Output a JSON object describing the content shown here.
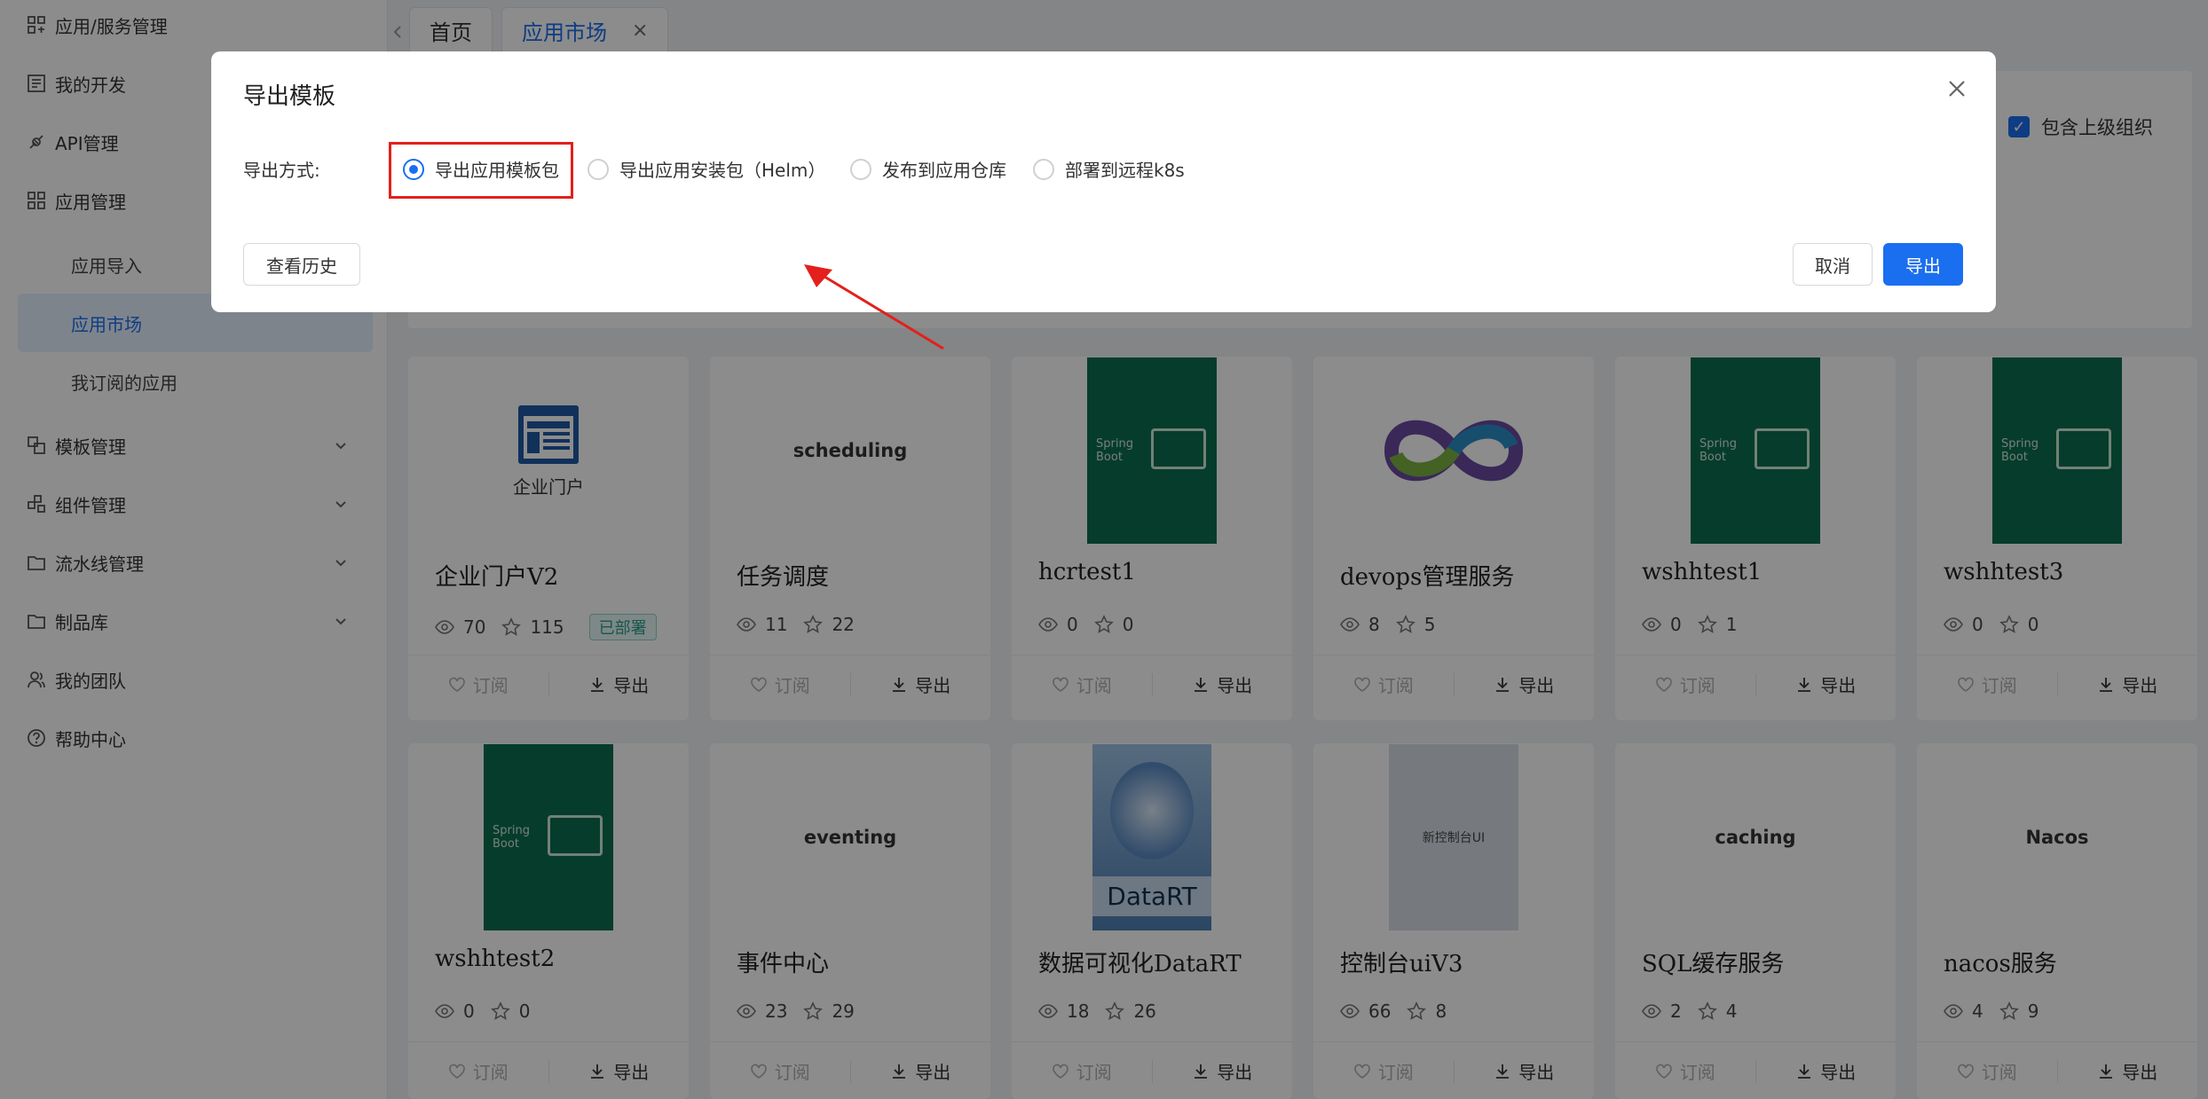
{
  "sidebar": {
    "items": [
      {
        "label": "应用/服务管理",
        "icon": "app-service-icon"
      },
      {
        "label": "我的开发",
        "icon": "dev-icon"
      },
      {
        "label": "API管理",
        "icon": "api-icon"
      },
      {
        "label": "应用管理",
        "icon": "grid-icon"
      },
      {
        "label": "模板管理",
        "icon": "template-icon"
      },
      {
        "label": "组件管理",
        "icon": "component-icon"
      },
      {
        "label": "流水线管理",
        "icon": "folder-icon"
      },
      {
        "label": "制品库",
        "icon": "folder-icon"
      },
      {
        "label": "我的团队",
        "icon": "team-icon"
      },
      {
        "label": "帮助中心",
        "icon": "help-icon"
      }
    ],
    "sub_items": [
      "应用导入",
      "应用市场",
      "我订阅的应用"
    ]
  },
  "tabs": [
    {
      "label": "首页"
    },
    {
      "label": "应用市场",
      "close": "×"
    }
  ],
  "toolbar": {
    "include_parent_label": "包含上级组织"
  },
  "cards": [
    {
      "title": "企业门户V2",
      "views": "70",
      "stars": "115",
      "badge": "已部署",
      "thumb_text": "企业门户",
      "thumb": "portal"
    },
    {
      "title": "任务调度",
      "views": "11",
      "stars": "22",
      "thumb_text": "scheduling",
      "thumb": "word"
    },
    {
      "title": "hcrtest1",
      "views": "0",
      "stars": "0",
      "thumb": "spring"
    },
    {
      "title": "devops管理服务",
      "views": "8",
      "stars": "5",
      "thumb": "devops"
    },
    {
      "title": "wshhtest1",
      "views": "0",
      "stars": "1",
      "thumb": "spring"
    },
    {
      "title": "wshhtest3",
      "views": "0",
      "stars": "0",
      "thumb": "spring"
    },
    {
      "title": "wshhtest2",
      "views": "0",
      "stars": "0",
      "thumb": "spring"
    },
    {
      "title": "事件中心",
      "views": "23",
      "stars": "29",
      "thumb_text": "eventing",
      "thumb": "word"
    },
    {
      "title": "数据可视化DataRT",
      "views": "18",
      "stars": "26",
      "thumb_text": "DataRT",
      "thumb": "datart"
    },
    {
      "title": "控制台uiV3",
      "views": "66",
      "stars": "8",
      "thumb_text": "新控制台UI",
      "thumb": "console"
    },
    {
      "title": "SQL缓存服务",
      "views": "2",
      "stars": "4",
      "thumb_text": "caching",
      "thumb": "word"
    },
    {
      "title": "nacos服务",
      "views": "4",
      "stars": "9",
      "thumb_text": "Nacos",
      "thumb": "word"
    }
  ],
  "card_actions": {
    "subscribe": "订阅",
    "export": "导出"
  },
  "spring_text": "Spring\nBoot",
  "modal": {
    "title": "导出模板",
    "field_label": "导出方式:",
    "options": [
      "导出应用模板包",
      "导出应用安装包（Helm）",
      "发布到应用仓库",
      "部署到远程k8s"
    ],
    "selected": 0,
    "history_button": "查看历史",
    "cancel_button": "取消",
    "export_button": "导出"
  },
  "colors": {
    "accent": "#1a6ff0",
    "highlight": "#e3201b",
    "spring_green": "#0b6e4f"
  }
}
